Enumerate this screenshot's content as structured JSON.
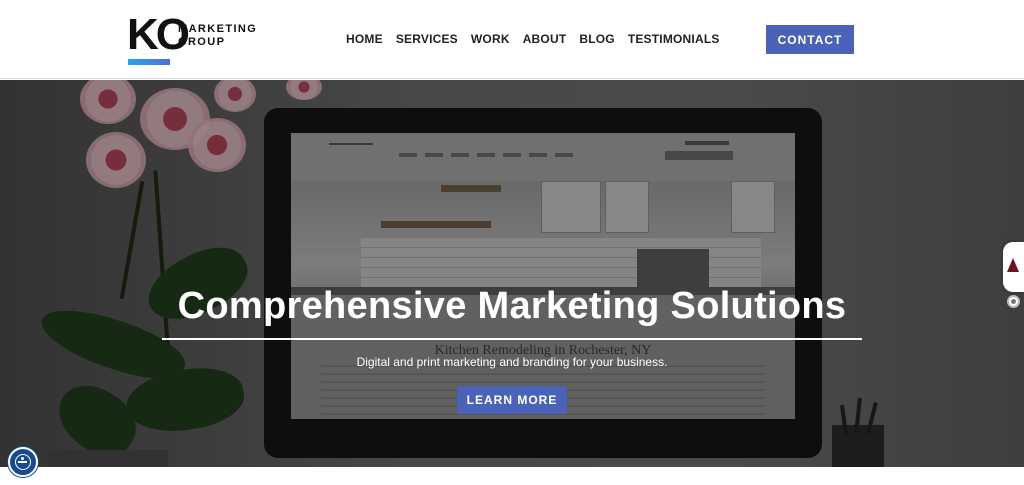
{
  "brand": {
    "logo_mark": "KO",
    "logo_line1": "MARKETING",
    "logo_line2": "GROUP"
  },
  "nav": {
    "items": [
      {
        "label": "HOME"
      },
      {
        "label": "SERVICES"
      },
      {
        "label": "WORK"
      },
      {
        "label": "ABOUT"
      },
      {
        "label": "BLOG"
      },
      {
        "label": "TESTIMONIALS"
      }
    ],
    "contact_label": "CONTACT"
  },
  "hero": {
    "title": "Comprehensive Marketing Solutions",
    "subtitle": "Digital and print marketing and branding for your business.",
    "button_label": "LEARN MORE",
    "background_screen_title": "Kitchen Remodeling in Rochester, NY"
  },
  "widgets": {
    "side_icon": "accessibility-person-icon",
    "settings_icon": "gear-icon",
    "accessibility_icon": "accessibility-icon"
  },
  "colors": {
    "accent": "#4a62b8",
    "logo_gradient_start": "#26a6e6",
    "logo_gradient_end": "#4f6fd8",
    "accessibility_blue": "#1a4a8c"
  }
}
